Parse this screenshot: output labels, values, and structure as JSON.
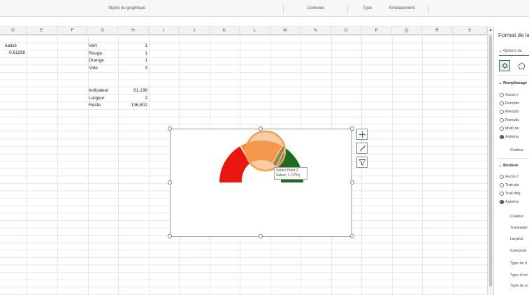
{
  "ribbon": {
    "groups": [
      "Styles du graphique",
      "Données",
      "Type",
      "Emplacement"
    ]
  },
  "sheet": {
    "columns": [
      "D",
      "E",
      "F",
      "G",
      "H",
      "I",
      "J",
      "K",
      "L",
      "M",
      "N",
      "O",
      "P",
      "Q",
      "R",
      "S"
    ],
    "d_cells": {
      "label": "éalisé",
      "value": "0,61198"
    },
    "table1": [
      {
        "label": "Vert",
        "value": "1"
      },
      {
        "label": "Rouge",
        "value": "1"
      },
      {
        "label": "Orange",
        "value": "1"
      },
      {
        "label": "Vide",
        "value": "3"
      }
    ],
    "table2": [
      {
        "label": "Indicateur",
        "value": "61,198"
      },
      {
        "label": "Largeur",
        "value": "2"
      },
      {
        "label": "Reste",
        "value": "136,802"
      }
    ]
  },
  "chart": {
    "tooltip_line1": "Série1 Point 2",
    "tooltip_line2": "Valeur: 1 (17%)",
    "segment_colors": {
      "red": "#e8170f",
      "orange": "#ee8a3a",
      "green": "#1d6b22"
    },
    "buttons": [
      "chart-elements",
      "chart-styles",
      "chart-filters"
    ]
  },
  "pane": {
    "title": "Format de la",
    "options_label": "Options du",
    "sections": {
      "fill": {
        "title": "Remplissage",
        "options": [
          {
            "label": "Aucun r",
            "selected": false
          },
          {
            "label": "Remplis",
            "selected": false
          },
          {
            "label": "Remplis",
            "selected": false
          },
          {
            "label": "Remplis",
            "selected": false
          },
          {
            "label": "Motif de",
            "selected": false
          },
          {
            "label": "Automa",
            "selected": true
          }
        ],
        "color_label": "Couleur"
      },
      "border": {
        "title": "Bordure",
        "options": [
          {
            "label": "Aucun t",
            "selected": false
          },
          {
            "label": "Trait ple",
            "selected": false
          },
          {
            "label": "Trait dég",
            "selected": false
          },
          {
            "label": "Automa",
            "selected": true
          }
        ],
        "props": [
          "Couleur",
          "Transpare",
          "Largeur",
          "Composit",
          "Type de ti",
          "Type d'ext",
          "Type de jo"
        ]
      }
    }
  },
  "colors": {
    "accent": "#2f7a4a"
  }
}
